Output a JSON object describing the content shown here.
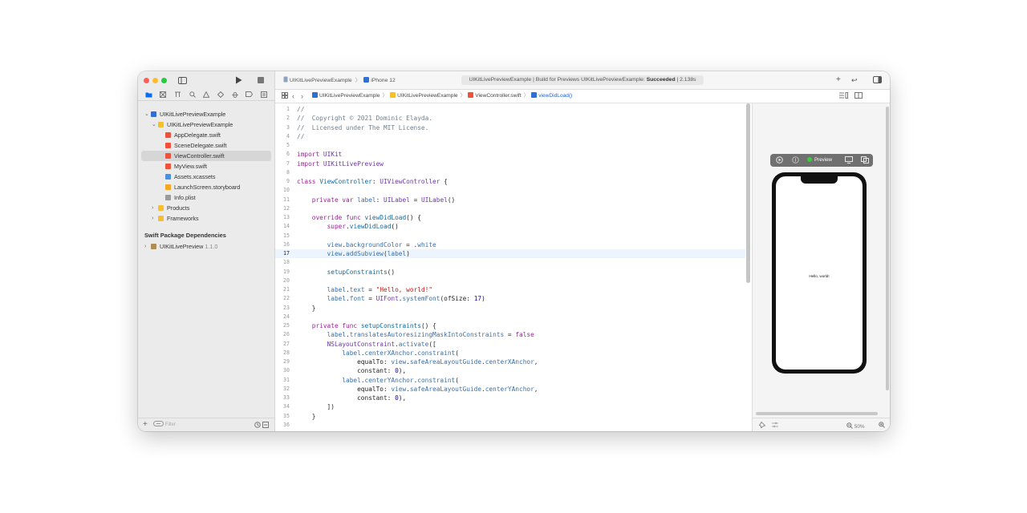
{
  "colors": {
    "close": "#fe5f57",
    "minimize": "#febc2e",
    "maximize": "#28c840",
    "accent": "#0a6cf5",
    "sidebar_bg": "#ebebeb",
    "highlight_line": "#ecf4fd"
  },
  "sidebar": {
    "toolbar_icons": [
      "sidebar-toggle-icon",
      "run-icon",
      "stop-icon"
    ],
    "nav_tabs": [
      "folder-icon",
      "source-control-icon",
      "hierarchy-icon",
      "search-icon",
      "warning-icon",
      "test-diamond-icon",
      "debug-icon",
      "breakpoint-icon",
      "report-icon"
    ],
    "tree": [
      {
        "label": "UIKitLivePreviewExample",
        "depth": 0,
        "chevron": "⌄",
        "kind": "project"
      },
      {
        "label": "UIKitLivePreviewExample",
        "depth": 1,
        "chevron": "⌄",
        "kind": "folder"
      },
      {
        "label": "AppDelegate.swift",
        "depth": 2,
        "chevron": "",
        "kind": "swift"
      },
      {
        "label": "SceneDelegate.swift",
        "depth": 2,
        "chevron": "",
        "kind": "swift"
      },
      {
        "label": "ViewController.swift",
        "depth": 2,
        "chevron": "",
        "kind": "swift",
        "selected": true
      },
      {
        "label": "MyView.swift",
        "depth": 2,
        "chevron": "",
        "kind": "swift"
      },
      {
        "label": "Assets.xcassets",
        "depth": 2,
        "chevron": "",
        "kind": "assets"
      },
      {
        "label": "LaunchScreen.storyboard",
        "depth": 2,
        "chevron": "",
        "kind": "storyboard"
      },
      {
        "label": "Info.plist",
        "depth": 2,
        "chevron": "",
        "kind": "plist"
      },
      {
        "label": "Products",
        "depth": 1,
        "chevron": "›",
        "kind": "folder"
      },
      {
        "label": "Frameworks",
        "depth": 1,
        "chevron": "›",
        "kind": "folder"
      }
    ],
    "packages_title": "Swift Package Dependencies",
    "package": {
      "name": "UIKitLivePreview",
      "version": "1.1.0"
    },
    "filter_placeholder": "Filter"
  },
  "toolbar": {
    "scheme": "UIKitLivePreviewExample",
    "device": "iPhone 12",
    "status_prefix": "UIKitLivePreviewExample | Build for Previews UIKitLivePreviewExample:",
    "status_result": "Succeeded",
    "status_time": "| 2.138s"
  },
  "jumpbar": {
    "crumbs": [
      "UIKitLivePreviewExample",
      "UIKitLivePreviewExample",
      "ViewController.swift",
      "viewDidLoad()"
    ]
  },
  "editor": {
    "current_line": 17,
    "lines": [
      "//",
      "//  Copyright © 2021 Dominic Elayda.",
      "//  Licensed under The MIT License.",
      "//",
      "",
      "import UIKit",
      "import UIKitLivePreview",
      "",
      "class ViewController: UIViewController {",
      "",
      "    private var label: UILabel = UILabel()",
      "",
      "    override func viewDidLoad() {",
      "        super.viewDidLoad()",
      "",
      "        view.backgroundColor = .white",
      "        view.addSubview(label)",
      "",
      "        setupConstraints()",
      "",
      "        label.text = \"Hello, world!\"",
      "        label.font = UIFont.systemFont(ofSize: 17)",
      "    }",
      "",
      "    private func setupConstraints() {",
      "        label.translatesAutoresizingMaskIntoConstraints = false",
      "        NSLayoutConstraint.activate([",
      "            label.centerXAnchor.constraint(",
      "                equalTo: view.safeAreaLayoutGuide.centerXAnchor,",
      "                constant: 0),",
      "            label.centerYAnchor.constraint(",
      "                equalTo: view.safeAreaLayoutGuide.centerYAnchor,",
      "                constant: 0),",
      "        ])",
      "    }",
      "",
      "}"
    ]
  },
  "preview": {
    "mode_label": "Preview",
    "hello_text": "Hello, world!",
    "zoom": "50%"
  }
}
